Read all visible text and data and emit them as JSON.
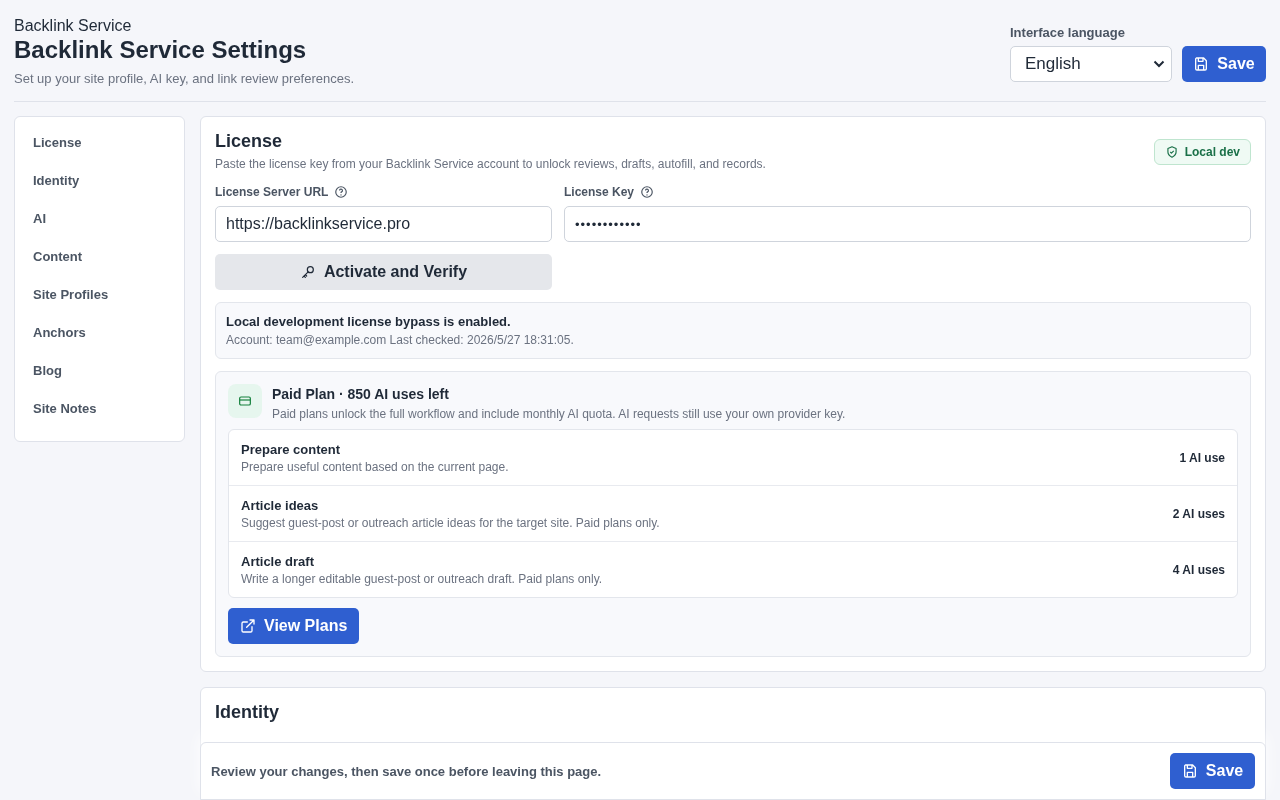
{
  "header": {
    "eyebrow": "Backlink Service",
    "title": "Backlink Service Settings",
    "subtitle": "Set up your site profile, AI key, and link review preferences."
  },
  "language": {
    "label": "Interface language",
    "value": "English"
  },
  "save_button": "Save",
  "sidebar": {
    "items": [
      {
        "label": "License",
        "selected": false
      },
      {
        "label": "Identity",
        "selected": false
      },
      {
        "label": "AI",
        "selected": false
      },
      {
        "label": "Content",
        "selected": false
      },
      {
        "label": "Site Profiles",
        "selected": false
      },
      {
        "label": "Anchors",
        "selected": false
      },
      {
        "label": "Blog",
        "selected": false
      },
      {
        "label": "Site Notes",
        "selected": false
      }
    ]
  },
  "license": {
    "title": "License",
    "description": "Paste the license key from your Backlink Service account to unlock reviews, drafts, autofill, and records.",
    "badge": "Local dev",
    "fields": [
      {
        "label": "License Server URL",
        "value": "https://backlinkservice.pro",
        "kind": "text"
      },
      {
        "label": "License Key",
        "value": "••••••••••••",
        "kind": "password"
      }
    ],
    "activate_button": "Activate and Verify",
    "status": {
      "title": "Local development license bypass is enabled.",
      "detail": "Account: team@example.com Last checked: 2026/5/27 18:31:05."
    },
    "plan": {
      "title": "Paid Plan · 850 AI uses left",
      "description": "Paid plans unlock the full workflow and include monthly AI quota. AI requests still use your own provider key.",
      "features": [
        {
          "name": "Prepare content",
          "description": "Prepare useful content based on the current page.",
          "cost": "1 AI use"
        },
        {
          "name": "Article ideas",
          "description": "Suggest guest-post or outreach article ideas for the target site. Paid plans only.",
          "cost": "2 AI uses"
        },
        {
          "name": "Article draft",
          "description": "Write a longer editable guest-post or outreach draft. Paid plans only.",
          "cost": "4 AI uses"
        }
      ],
      "button": "View Plans"
    }
  },
  "identity": {
    "title": "Identity"
  },
  "footer": {
    "message": "Review your changes, then save once before leaving this page.",
    "button": "Save"
  }
}
